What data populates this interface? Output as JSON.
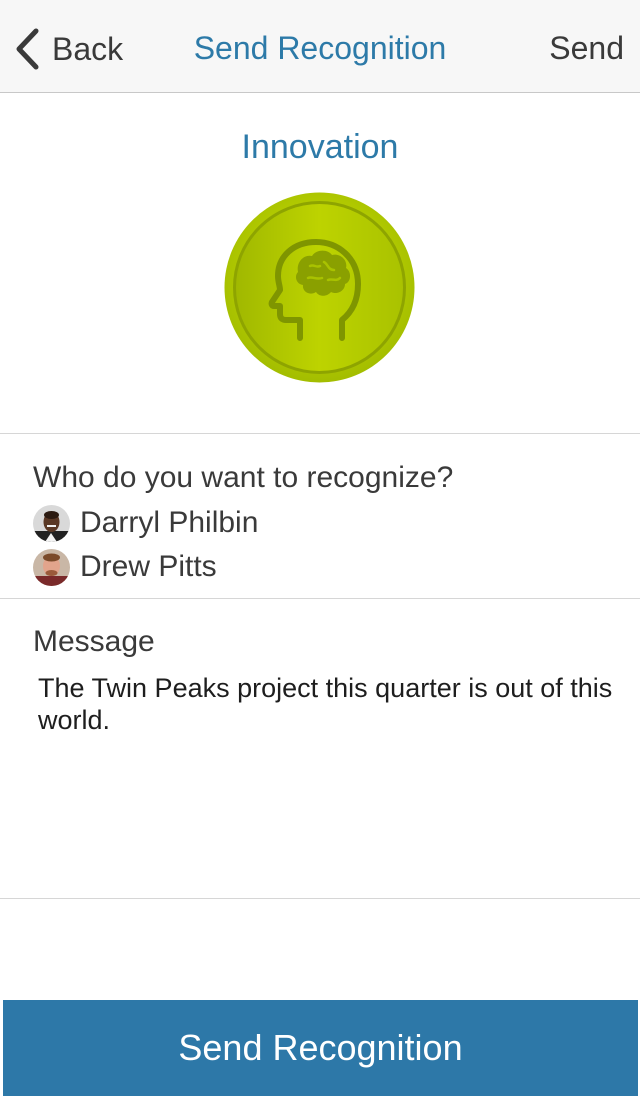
{
  "navbar": {
    "back_label": "Back",
    "title": "Send Recognition",
    "send_label": "Send",
    "back_icon": "chevron-left-icon"
  },
  "badge": {
    "name": "Innovation",
    "icon": "head-brain-icon",
    "colors": {
      "medal_outer": "#a7c400",
      "medal_inner": "#b8cf00",
      "medal_ring": "#8ea400",
      "icon": "#7f9500"
    }
  },
  "recipients": {
    "prompt": "Who do you want to recognize?",
    "people": [
      {
        "name": "Darryl Philbin"
      },
      {
        "name": "Drew Pitts"
      }
    ]
  },
  "message": {
    "label": "Message",
    "value": "The Twin Peaks project this quarter is out of this world."
  },
  "footer": {
    "button_label": "Send Recognition",
    "button_color": "#2d78a8"
  },
  "theme": {
    "accent": "#2d7aa8"
  }
}
